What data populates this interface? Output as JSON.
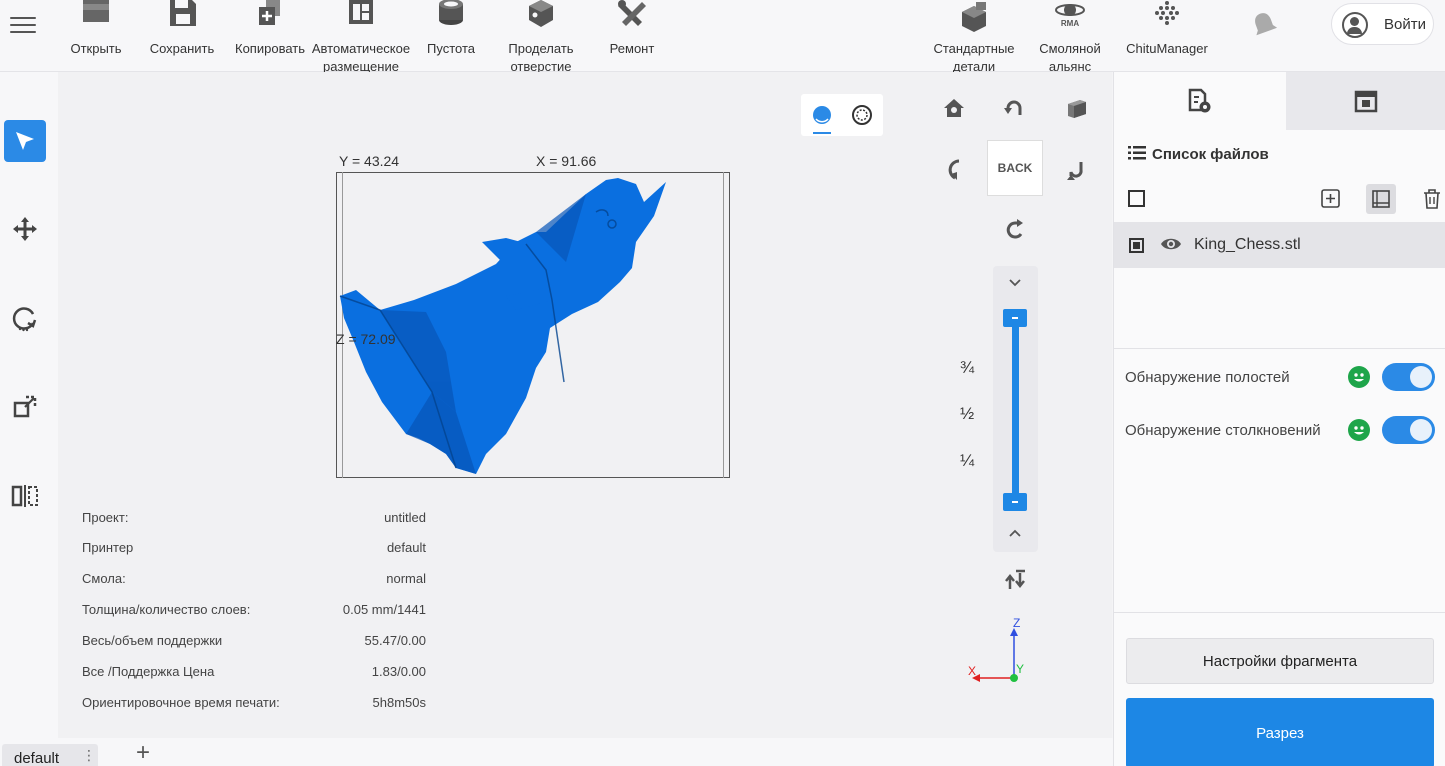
{
  "toolbar": {
    "items": [
      {
        "label": "Открыть",
        "icon": "open-icon"
      },
      {
        "label": "Сохранить",
        "icon": "save-icon"
      },
      {
        "label": "Копировать",
        "icon": "copy-icon"
      },
      {
        "label": "Автоматическое\nразмещение",
        "icon": "auto-layout-icon"
      },
      {
        "label": "Пустота",
        "icon": "hollow-icon"
      },
      {
        "label": "Проделать\nотверстие",
        "icon": "punch-hole-icon"
      },
      {
        "label": "Ремонт",
        "icon": "repair-icon"
      }
    ],
    "right_items": [
      {
        "label": "Стандартные\nдетали",
        "icon": "standard-parts-icon"
      },
      {
        "label": "Смоляной\nальянс",
        "icon": "resin-alliance-icon",
        "badge": "RMA"
      },
      {
        "label": "ChituManager",
        "icon": "chitumanager-icon"
      }
    ],
    "login_label": "Войти"
  },
  "viewport": {
    "dims": {
      "y": "Y = 43.24",
      "x": "X = 91.66",
      "z": "Z = 72.09"
    },
    "back_label": "BACK",
    "slider_marks": [
      "¾",
      "½",
      "¼"
    ],
    "axes": {
      "x": "X",
      "y": "Y",
      "z": "Z"
    },
    "model_color": "#0a6fe0"
  },
  "info": {
    "rows": [
      {
        "key": "Проект:",
        "value": "untitled"
      },
      {
        "key": "Принтер",
        "value": "default"
      },
      {
        "key": "Смола:",
        "value": "normal"
      },
      {
        "key": "Толщина/количество слоев:",
        "value": "0.05 mm/1441"
      },
      {
        "key": "Весь/объем поддержки",
        "value": "55.47/0.00"
      },
      {
        "key": "Все /Поддержка Цена",
        "value": "1.83/0.00"
      },
      {
        "key": "Ориентировочное время печати:",
        "value": "5h8m50s"
      }
    ]
  },
  "right_panel": {
    "file_list_title": "Список файлов",
    "files": [
      {
        "name": "King_Chess.stl"
      }
    ],
    "toggles": [
      {
        "label": "Обнаружение полостей",
        "on": true
      },
      {
        "label": "Обнаружение столкновений",
        "on": true
      }
    ],
    "slice_settings_label": "Настройки фрагмента",
    "slice_label": "Разрез"
  },
  "bottom": {
    "tabs": [
      {
        "label": "default"
      }
    ],
    "add_label": "+"
  },
  "colors": {
    "accent": "#2b8ae6",
    "model": "#0a6fe0",
    "ok_green": "#1ea54a",
    "axis_x": "#e02020",
    "axis_y": "#20c040",
    "axis_z": "#3050e0"
  }
}
